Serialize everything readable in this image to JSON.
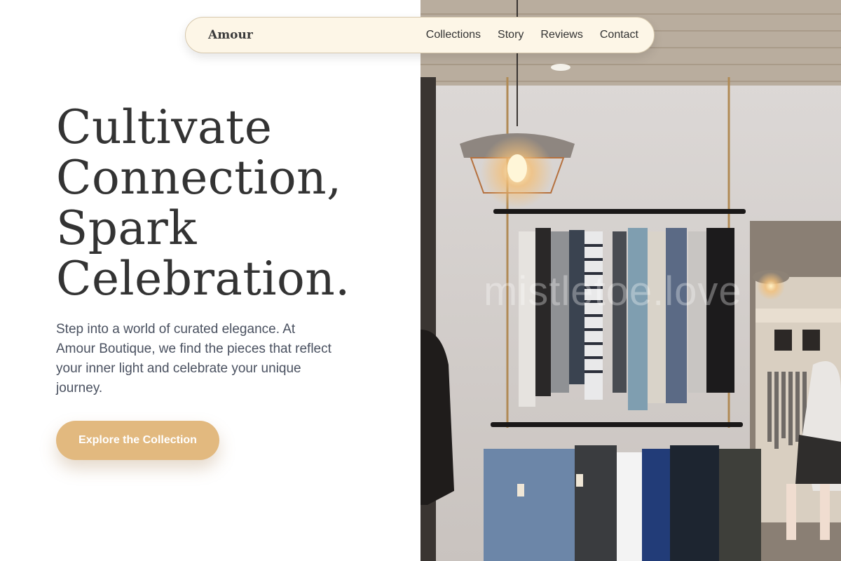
{
  "nav": {
    "brand": "Amour",
    "links": [
      "Collections",
      "Story",
      "Reviews",
      "Contact"
    ]
  },
  "hero": {
    "title_lines": [
      "Cultivate",
      "Connection,",
      "Spark",
      "Celebration."
    ],
    "description": "Step into a world of curated elegance. At Amour Boutique, we find the pieces that reflect your inner light and celebrate your unique journey.",
    "cta_label": "Explore the Collection"
  },
  "image": {
    "watermark": "mistletoe.love",
    "alt_icon": "boutique-clothing-rack-photo"
  },
  "colors": {
    "accent": "#e2b97f",
    "nav_bg": "#fdf6e7",
    "title": "#333333",
    "body_text": "#4a5160"
  }
}
